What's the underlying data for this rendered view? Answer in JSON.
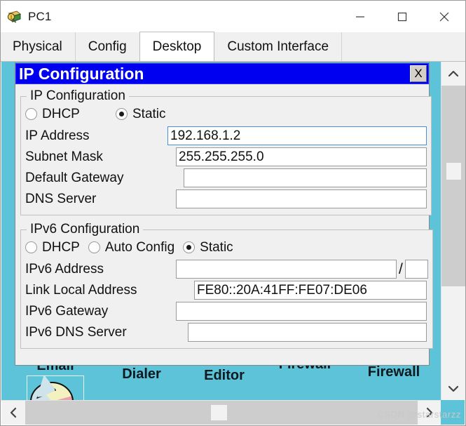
{
  "window": {
    "title": "PC1",
    "icon": "packet-tracer-inspect-icon",
    "controls": {
      "minimize": "–",
      "maximize": "□",
      "close": "✕"
    }
  },
  "tabs": [
    {
      "label": "Physical",
      "active": false
    },
    {
      "label": "Config",
      "active": false
    },
    {
      "label": "Desktop",
      "active": true
    },
    {
      "label": "Custom Interface",
      "active": false
    }
  ],
  "dialog": {
    "title": "IP Configuration",
    "close_label": "X",
    "ipv4": {
      "legend": "IP Configuration",
      "modes": [
        {
          "label": "DHCP",
          "selected": false
        },
        {
          "label": "Static",
          "selected": true
        }
      ],
      "fields": [
        {
          "label": "IP Address",
          "value": "192.168.1.2",
          "focused": true
        },
        {
          "label": "Subnet Mask",
          "value": "255.255.255.0",
          "focused": false
        },
        {
          "label": "Default Gateway",
          "value": "",
          "focused": false
        },
        {
          "label": "DNS Server",
          "value": "",
          "focused": false
        }
      ]
    },
    "ipv6": {
      "legend": "IPv6 Configuration",
      "modes": [
        {
          "label": "DHCP",
          "selected": false
        },
        {
          "label": "Auto Config",
          "selected": false
        },
        {
          "label": "Static",
          "selected": true
        }
      ],
      "address_label": "IPv6 Address",
      "address_value": "",
      "prefix_separator": "/",
      "prefix_value": "",
      "fields": [
        {
          "label": "Link Local Address",
          "value": "FE80::20A:41FF:FE07:DE06"
        },
        {
          "label": "IPv6 Gateway",
          "value": ""
        },
        {
          "label": "IPv6 DNS Server",
          "value": ""
        }
      ]
    }
  },
  "desktop_icons": [
    {
      "label": "Email",
      "icon": "pie-chart-icon"
    },
    {
      "label": "Dialer",
      "icon": "dialer-icon"
    },
    {
      "label": "Editor",
      "icon": "editor-icon"
    },
    {
      "label": "Firewall",
      "icon": "firewall-icon"
    },
    {
      "label": "Firewall",
      "icon": "ipv6-firewall-icon"
    }
  ],
  "scrollbars": {
    "vertical": {
      "up": "chevron-up-icon",
      "down": "chevron-down-icon"
    },
    "horizontal": {
      "left": "chevron-left-icon",
      "right": "chevron-right-icon"
    }
  },
  "watermark": "CSDN @starstarzz",
  "colors": {
    "desktop_teal": "#5cc3d8",
    "dialog_title_blue": "#0000f0",
    "focus_border": "#4a90d9",
    "panel_gray": "#f0f0f0"
  }
}
